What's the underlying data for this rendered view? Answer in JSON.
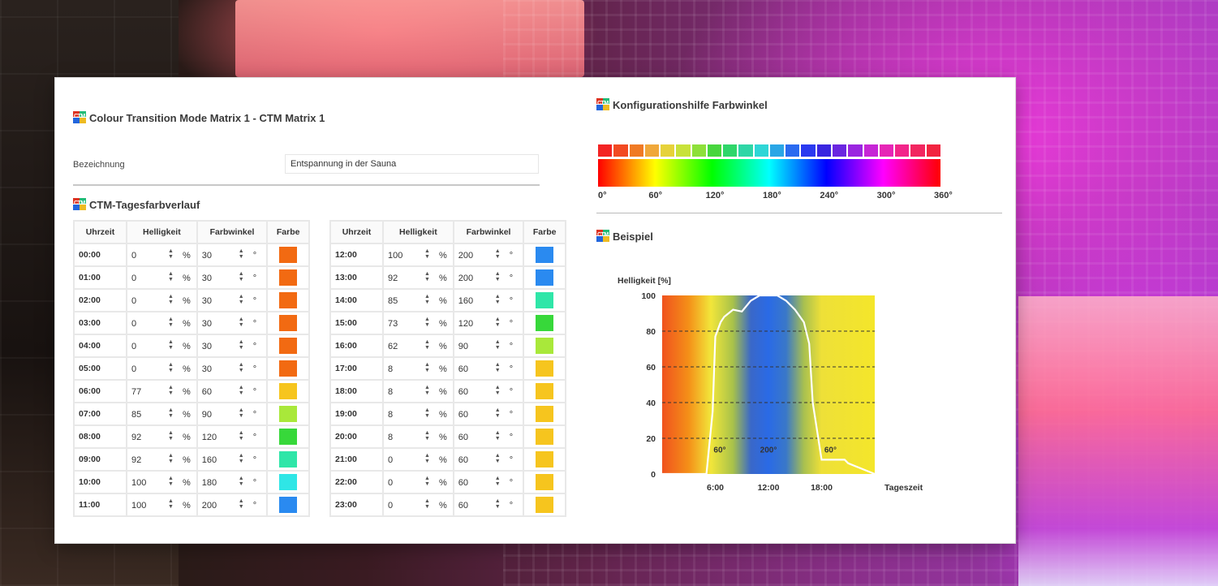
{
  "main": {
    "title": "Colour Transition Mode Matrix 1 - CTM Matrix 1",
    "name_label": "Bezeichnung",
    "name_value": "Entspannung in der Sauna",
    "schedule_title": "CTM-Tagesfarbverlauf",
    "columns": {
      "time": "Uhrzeit",
      "brightness": "Helligkeit",
      "hue": "Farbwinkel",
      "color": "Farbe"
    },
    "units": {
      "percent": "%",
      "degree": "°"
    },
    "stepper_glyph": "▲\n▼",
    "rows_left": [
      {
        "time": "00:00",
        "brightness": "0",
        "hue": "30",
        "color": "#f26a12"
      },
      {
        "time": "01:00",
        "brightness": "0",
        "hue": "30",
        "color": "#f26a12"
      },
      {
        "time": "02:00",
        "brightness": "0",
        "hue": "30",
        "color": "#f26a12"
      },
      {
        "time": "03:00",
        "brightness": "0",
        "hue": "30",
        "color": "#f26a12"
      },
      {
        "time": "04:00",
        "brightness": "0",
        "hue": "30",
        "color": "#f26a12"
      },
      {
        "time": "05:00",
        "brightness": "0",
        "hue": "30",
        "color": "#f26a12"
      },
      {
        "time": "06:00",
        "brightness": "77",
        "hue": "60",
        "color": "#f6c51e"
      },
      {
        "time": "07:00",
        "brightness": "85",
        "hue": "90",
        "color": "#a9e83a"
      },
      {
        "time": "08:00",
        "brightness": "92",
        "hue": "120",
        "color": "#37d83a"
      },
      {
        "time": "09:00",
        "brightness": "92",
        "hue": "160",
        "color": "#2fe6a8"
      },
      {
        "time": "10:00",
        "brightness": "100",
        "hue": "180",
        "color": "#2fe6e6"
      },
      {
        "time": "11:00",
        "brightness": "100",
        "hue": "200",
        "color": "#2a8af0"
      }
    ],
    "rows_right": [
      {
        "time": "12:00",
        "brightness": "100",
        "hue": "200",
        "color": "#2a8af0"
      },
      {
        "time": "13:00",
        "brightness": "92",
        "hue": "200",
        "color": "#2a8af0"
      },
      {
        "time": "14:00",
        "brightness": "85",
        "hue": "160",
        "color": "#2fe6a8"
      },
      {
        "time": "15:00",
        "brightness": "73",
        "hue": "120",
        "color": "#37d83a"
      },
      {
        "time": "16:00",
        "brightness": "62",
        "hue": "90",
        "color": "#a9e83a"
      },
      {
        "time": "17:00",
        "brightness": "8",
        "hue": "60",
        "color": "#f6c51e"
      },
      {
        "time": "18:00",
        "brightness": "8",
        "hue": "60",
        "color": "#f6c51e"
      },
      {
        "time": "19:00",
        "brightness": "8",
        "hue": "60",
        "color": "#f6c51e"
      },
      {
        "time": "20:00",
        "brightness": "8",
        "hue": "60",
        "color": "#f6c51e"
      },
      {
        "time": "21:00",
        "brightness": "0",
        "hue": "60",
        "color": "#f6c51e"
      },
      {
        "time": "22:00",
        "brightness": "0",
        "hue": "60",
        "color": "#f6c51e"
      },
      {
        "time": "23:00",
        "brightness": "0",
        "hue": "60",
        "color": "#f6c51e"
      }
    ]
  },
  "helper": {
    "title": "Konfigurationshilfe Farbwinkel",
    "square_colors": [
      "#f32424",
      "#f24a22",
      "#f07a24",
      "#f0a83a",
      "#e6d23a",
      "#c8e23a",
      "#8ee03a",
      "#48d63e",
      "#2fd66a",
      "#2fd6a6",
      "#2fd6d6",
      "#2aa6e6",
      "#2a6af0",
      "#2a3af0",
      "#3a26e0",
      "#6a26e0",
      "#9a26e0",
      "#c626d6",
      "#e626b6",
      "#f2268a",
      "#f22660",
      "#f22440"
    ],
    "ticks": [
      "0°",
      "60°",
      "120°",
      "180°",
      "240°",
      "300°",
      "360°"
    ]
  },
  "example": {
    "title": "Beispiel",
    "chart_data": {
      "type": "line",
      "ylabel": "Helligkeit [%]",
      "xlabel": "Tageszeit",
      "ylim": [
        0,
        100
      ],
      "xlim": [
        0,
        24
      ],
      "yticks": [
        "0",
        "20",
        "40",
        "60",
        "80",
        "100"
      ],
      "xticks": [
        {
          "x": 6,
          "label": "6:00"
        },
        {
          "x": 12,
          "label": "12:00"
        },
        {
          "x": 18,
          "label": "18:00"
        }
      ],
      "grid": "dashed horizontal",
      "background_hue_stops": [
        {
          "x": 0,
          "color": "#f0521e"
        },
        {
          "x": 3,
          "color": "#f49018"
        },
        {
          "x": 5.5,
          "color": "#f2e63a"
        },
        {
          "x": 8,
          "color": "#a8c24a"
        },
        {
          "x": 10,
          "color": "#3a68c8"
        },
        {
          "x": 12,
          "color": "#2a6ae6"
        },
        {
          "x": 14,
          "color": "#3a78c8"
        },
        {
          "x": 16,
          "color": "#a8c050"
        },
        {
          "x": 18,
          "color": "#eee038"
        },
        {
          "x": 24,
          "color": "#f4e62a"
        }
      ],
      "hue_labels": [
        {
          "x": 6.5,
          "label": "60°"
        },
        {
          "x": 12,
          "label": "200°"
        },
        {
          "x": 19,
          "label": "60°"
        }
      ],
      "series": [
        {
          "x": [
            0,
            5,
            5.7,
            6,
            6.6,
            7,
            8,
            9,
            10,
            11,
            12,
            13,
            14,
            15,
            16,
            16.6,
            17,
            18,
            19,
            20,
            20.6,
            21,
            24
          ],
          "values": [
            0,
            0,
            35,
            77,
            85,
            88,
            92,
            91,
            97,
            100,
            100,
            100,
            97,
            92,
            85,
            73,
            40,
            8,
            8,
            8,
            8,
            6,
            0
          ]
        }
      ]
    }
  }
}
